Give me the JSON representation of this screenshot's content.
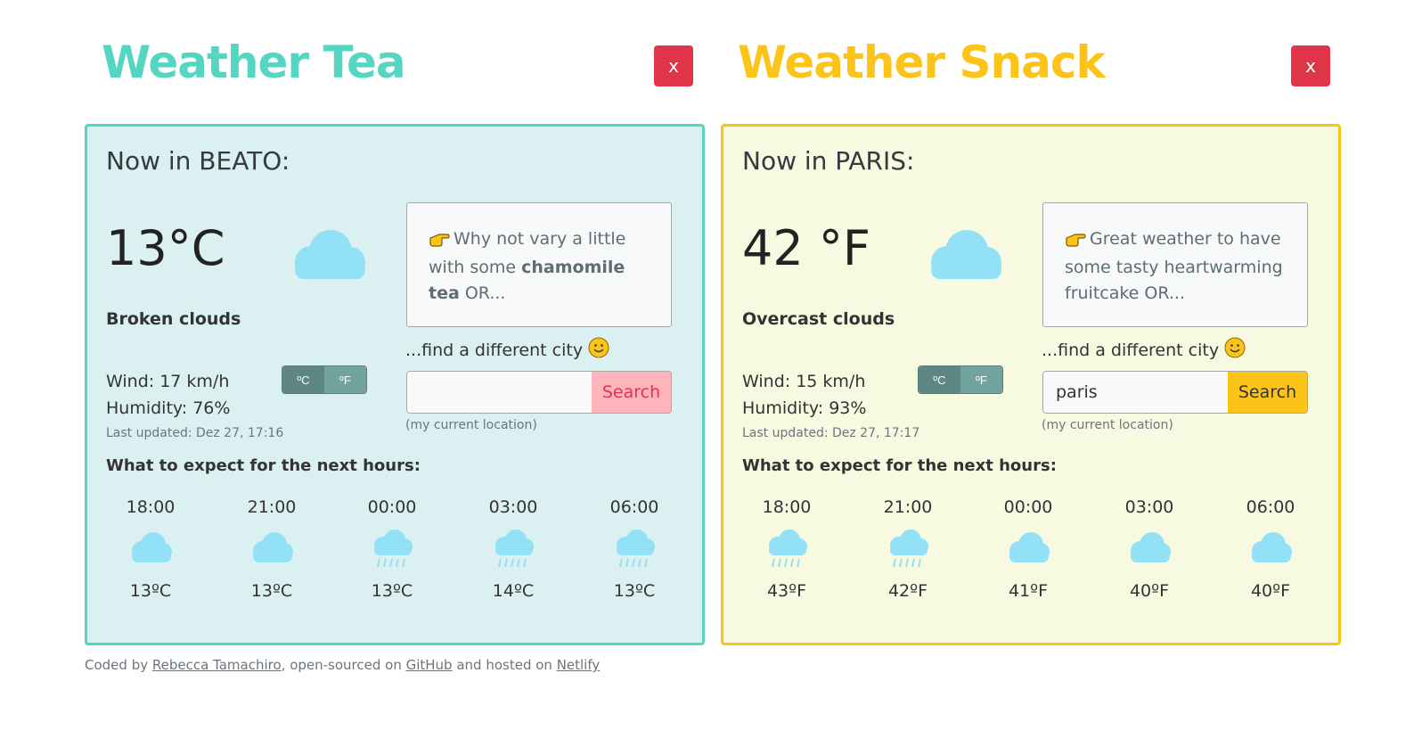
{
  "tea": {
    "title": "Weather Tea",
    "close_label": "x",
    "now_label": "Now in BEATO:",
    "temperature": "13°C",
    "description": "Broken clouds",
    "wind": "Wind: 17 km/h",
    "humidity": "Humidity: 76%",
    "last_updated": "Last updated: Dez 27, 17:16",
    "unit_c": "ºC",
    "unit_f": "ºF",
    "advice_pre": "Why not vary a little with some ",
    "advice_bold": "chamomile tea",
    "advice_post": " OR...",
    "find_label": "...find a different city",
    "search_value": "",
    "search_label": "Search",
    "location_link": "(my current location)",
    "next_hours_title": "What to expect for the next hours:",
    "forecast": [
      {
        "time": "18:00",
        "icon": "cloud-icon",
        "temp": "13ºC"
      },
      {
        "time": "21:00",
        "icon": "cloud-icon",
        "temp": "13ºC"
      },
      {
        "time": "00:00",
        "icon": "rain-cloud-icon",
        "temp": "13ºC"
      },
      {
        "time": "03:00",
        "icon": "rain-cloud-icon",
        "temp": "14ºC"
      },
      {
        "time": "06:00",
        "icon": "rain-cloud-icon",
        "temp": "13ºC"
      }
    ]
  },
  "snack": {
    "title": "Weather Snack",
    "close_label": "x",
    "now_label": "Now in PARIS:",
    "temperature": "42 °F",
    "description": "Overcast clouds",
    "wind": "Wind: 15 km/h",
    "humidity": "Humidity: 93%",
    "last_updated": "Last updated: Dez 27, 17:17",
    "unit_c": "ºC",
    "unit_f": "ºF",
    "advice_pre": "Great weather to have some tasty heartwarming fruitcake OR...",
    "advice_bold": "",
    "advice_post": "",
    "find_label": "...find a different city",
    "search_value": "paris",
    "search_label": "Search",
    "location_link": "(my current location)",
    "next_hours_title": "What to expect for the next hours:",
    "forecast": [
      {
        "time": "18:00",
        "icon": "rain-cloud-icon",
        "temp": "43ºF"
      },
      {
        "time": "21:00",
        "icon": "rain-cloud-icon",
        "temp": "42ºF"
      },
      {
        "time": "00:00",
        "icon": "cloud-icon",
        "temp": "41ºF"
      },
      {
        "time": "03:00",
        "icon": "cloud-icon",
        "temp": "40ºF"
      },
      {
        "time": "06:00",
        "icon": "cloud-icon",
        "temp": "40ºF"
      }
    ]
  },
  "footer": {
    "prefix": "Coded by ",
    "author": "Rebecca Tamachiro",
    "mid1": ", open-sourced on ",
    "github": "GitHub",
    "mid2": " and hosted on ",
    "netlify": "Netlify"
  },
  "colors": {
    "tea_accent": "#55d6c2",
    "snack_accent": "#fcc419",
    "close_red": "#e03549",
    "cloud_blue": "#92e1f6"
  }
}
